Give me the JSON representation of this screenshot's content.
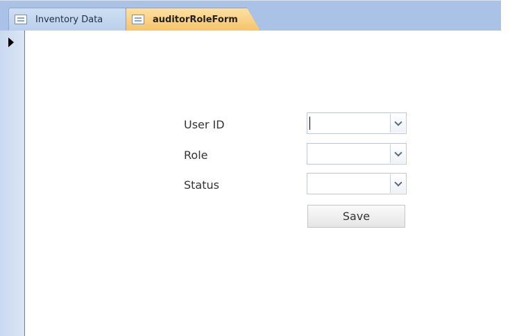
{
  "tabs": [
    {
      "label": "Inventory Data",
      "icon": "form-icon",
      "active": false
    },
    {
      "label": "auditorRoleForm",
      "icon": "form-icon",
      "active": true
    }
  ],
  "record_selector": {
    "icon": "current-record-pointer-icon"
  },
  "form": {
    "fields": [
      {
        "label": "User ID",
        "value": "",
        "has_focus": true
      },
      {
        "label": "Role",
        "value": ""
      },
      {
        "label": "Status",
        "value": ""
      }
    ],
    "save_label": "Save"
  },
  "colors": {
    "tabbar": "#a9c2e6",
    "inactive_tab": "#c6d8f0",
    "active_tab": "#f9cf7f",
    "record_strip": "#d2e1f3",
    "save_button": "#ededed"
  }
}
